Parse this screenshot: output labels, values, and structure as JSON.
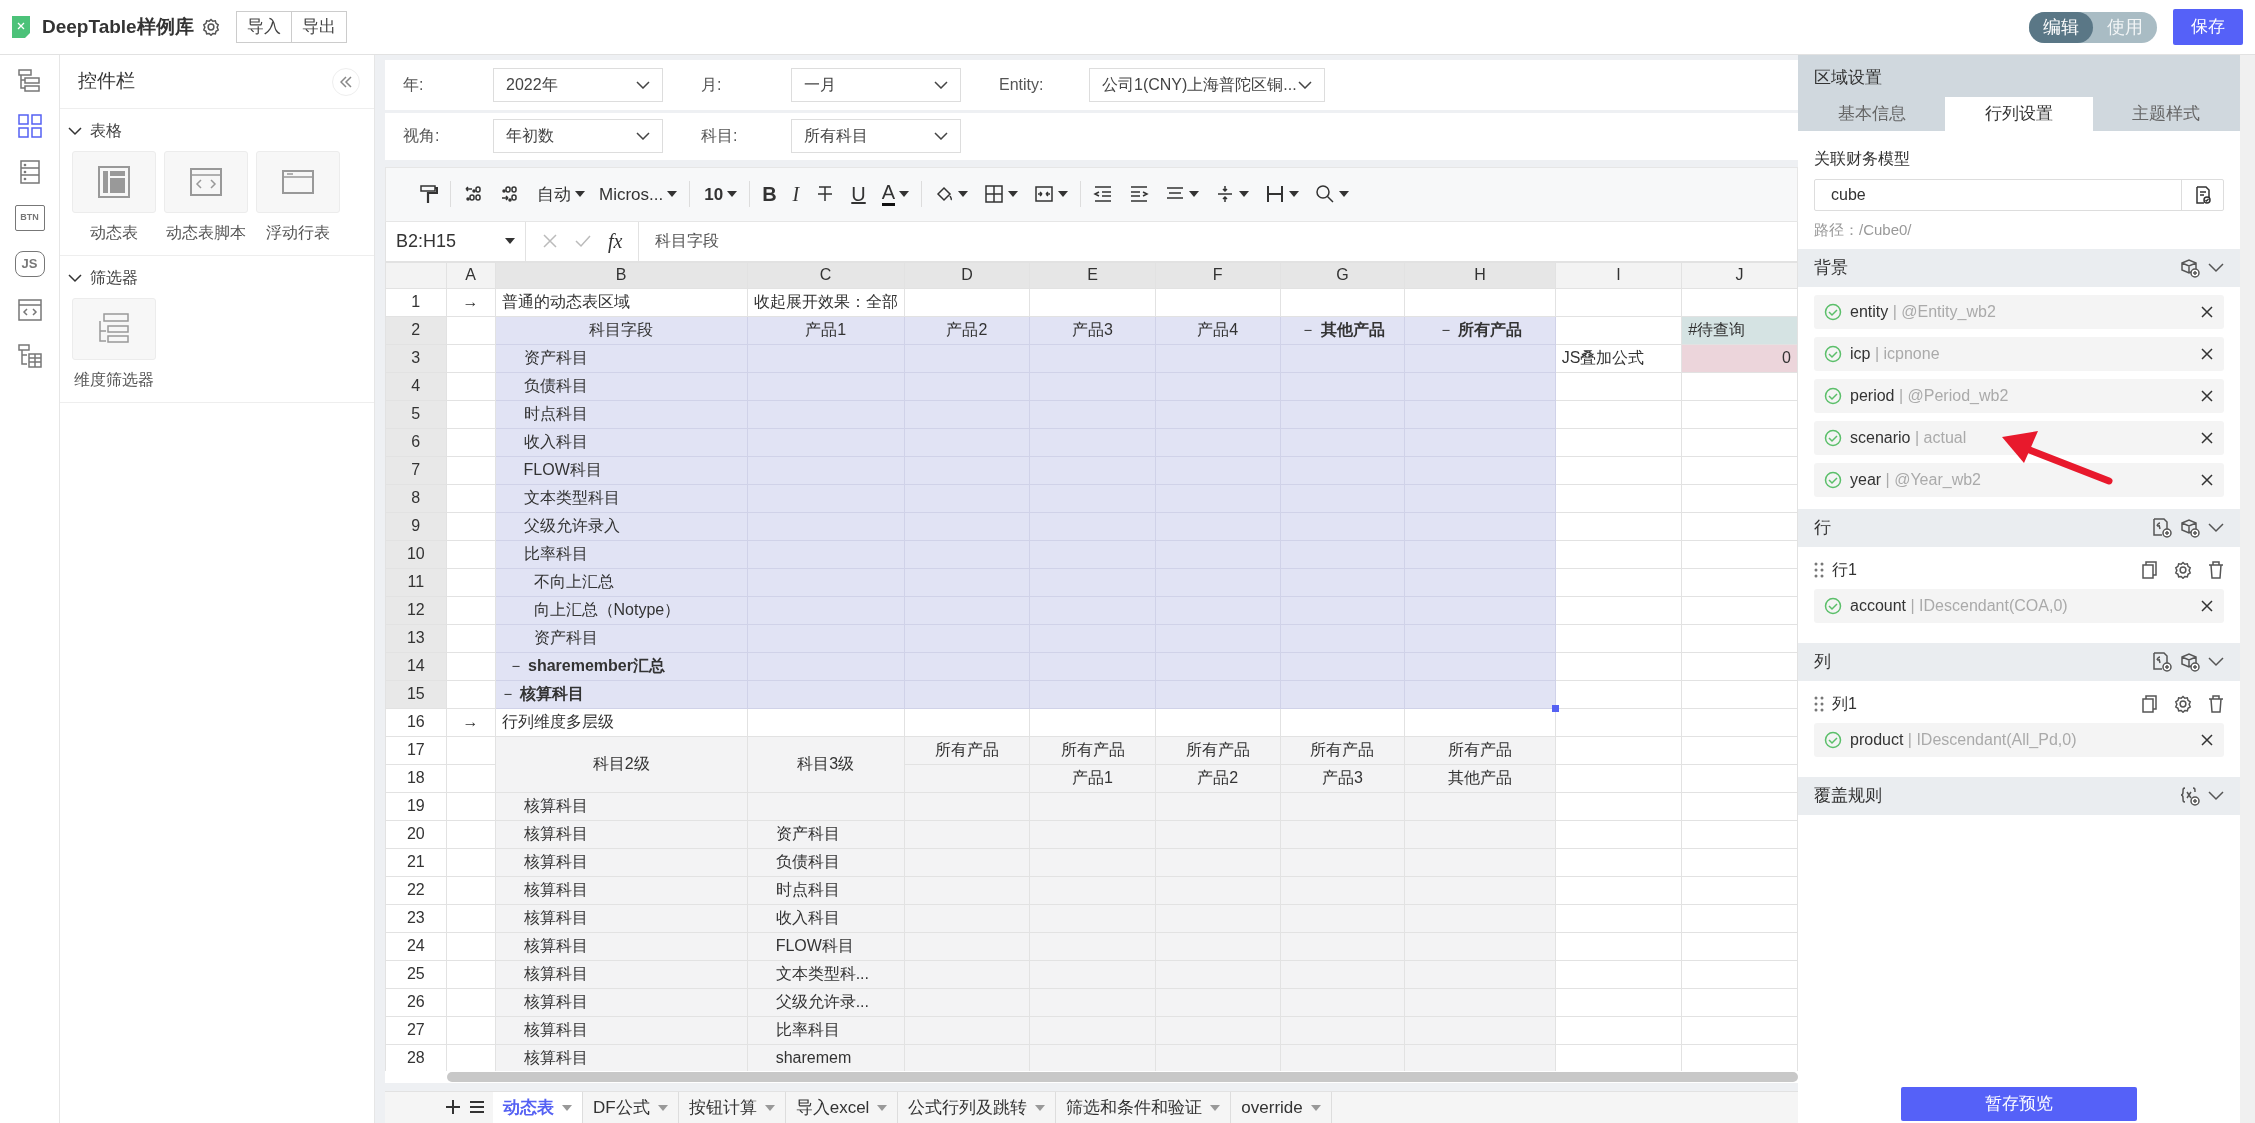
{
  "app": {
    "title": "DeepTable样例库",
    "actions": [
      "导入",
      "导出"
    ],
    "modes": [
      {
        "label": "编辑",
        "selected": true
      },
      {
        "label": "使用",
        "selected": false
      }
    ],
    "save": "保存"
  },
  "rail": [
    {
      "kind": "outline",
      "selected": false
    },
    {
      "kind": "widgets",
      "selected": true
    },
    {
      "kind": "list",
      "selected": false
    },
    {
      "kind": "btn",
      "label": "BTN",
      "selected": false
    },
    {
      "kind": "js",
      "label": "JS",
      "selected": false
    },
    {
      "kind": "code",
      "selected": false
    },
    {
      "kind": "tree-table",
      "selected": false
    }
  ],
  "control_panel": {
    "title": "控件栏",
    "groups": [
      {
        "label": "表格",
        "items": [
          {
            "kind": "dynamic",
            "label": "动态表"
          },
          {
            "kind": "script",
            "label": "动态表脚本"
          },
          {
            "kind": "float",
            "label": "浮动行表"
          }
        ]
      },
      {
        "label": "筛选器",
        "items": [
          {
            "kind": "filter",
            "label": "维度筛选器"
          }
        ]
      }
    ]
  },
  "filters": [
    [
      {
        "label": "年:",
        "value": "2022年"
      },
      {
        "label": "月:",
        "value": "一月"
      },
      {
        "label": "Entity:",
        "value": "公司1(CNY)上海普陀区铜..."
      }
    ],
    [
      {
        "label": "视角:",
        "value": "年初数"
      },
      {
        "label": "科目:",
        "value": "所有科目"
      }
    ]
  ],
  "toolbar": [
    {
      "kind": "format-painter"
    },
    {
      "kind": "sep"
    },
    {
      "kind": "decimal-add"
    },
    {
      "kind": "decimal-remove"
    },
    {
      "kind": "select",
      "value": "自动"
    },
    {
      "kind": "select",
      "value": "Micros..."
    },
    {
      "kind": "sep"
    },
    {
      "kind": "select",
      "value": "10",
      "bold": true
    },
    {
      "kind": "sep"
    },
    {
      "kind": "glyph",
      "glyph": "B",
      "bold": true
    },
    {
      "kind": "glyph",
      "glyph": "I",
      "italic": true
    },
    {
      "kind": "strike"
    },
    {
      "kind": "glyph",
      "glyph": "U",
      "underline": true
    },
    {
      "kind": "font-color",
      "glyph": "A"
    },
    {
      "kind": "sep"
    },
    {
      "kind": "fill"
    },
    {
      "kind": "border"
    },
    {
      "kind": "merge"
    },
    {
      "kind": "sep"
    },
    {
      "kind": "outdent"
    },
    {
      "kind": "indent"
    },
    {
      "kind": "align"
    },
    {
      "kind": "valign"
    },
    {
      "kind": "width"
    },
    {
      "kind": "search"
    }
  ],
  "formula_bar": {
    "name_box": "B2:H15",
    "fx": "fx",
    "value": "科目字段"
  },
  "grid": {
    "columns": [
      {
        "letter": "A",
        "selected": false
      },
      {
        "letter": "B",
        "selected": true
      },
      {
        "letter": "C",
        "selected": true
      },
      {
        "letter": "D",
        "selected": true
      },
      {
        "letter": "E",
        "selected": true
      },
      {
        "letter": "F",
        "selected": true
      },
      {
        "letter": "G",
        "selected": true
      },
      {
        "letter": "H",
        "selected": true
      },
      {
        "letter": "I",
        "selected": false
      },
      {
        "letter": "J",
        "selected": false
      }
    ],
    "rows": [
      {
        "num": "1",
        "kind": "title",
        "selected": false,
        "cells": [
          {
            "text": "→",
            "kind": "mark"
          },
          {
            "text": "普通的动态表区域"
          },
          {
            "text": "收起展开效果：全部"
          },
          null,
          null,
          null,
          null,
          null,
          null,
          null
        ]
      },
      {
        "num": "2",
        "kind": "dynamic",
        "selected": true,
        "cells": [
          null,
          {
            "text": "科目字段",
            "kind": "head"
          },
          {
            "text": "产品1",
            "kind": "head"
          },
          {
            "text": "产品2",
            "kind": "head"
          },
          {
            "text": "产品3",
            "kind": "head"
          },
          {
            "text": "产品4",
            "kind": "head"
          },
          {
            "text": "－ **其他产品**",
            "kind": "head"
          },
          {
            "text": "－ **所有产品**",
            "kind": "head"
          },
          null,
          {
            "text": "#待查询",
            "kind": "query"
          }
        ]
      },
      {
        "num": "3",
        "kind": "dynamic",
        "selected": true,
        "cells": [
          null,
          {
            "text": "资产科目",
            "kind": "item"
          },
          null,
          null,
          null,
          null,
          null,
          null,
          {
            "text": "JS叠加公式"
          },
          {
            "text": "0",
            "kind": "value"
          }
        ]
      },
      {
        "num": "4",
        "kind": "dynamic",
        "selected": true,
        "cells": [
          null,
          {
            "text": "负债科目",
            "kind": "item"
          },
          null,
          null,
          null,
          null,
          null,
          null,
          null,
          null
        ]
      },
      {
        "num": "5",
        "kind": "dynamic",
        "selected": true,
        "cells": [
          null,
          {
            "text": "时点科目",
            "kind": "item"
          },
          null,
          null,
          null,
          null,
          null,
          null,
          null,
          null
        ]
      },
      {
        "num": "6",
        "kind": "dynamic",
        "selected": true,
        "cells": [
          null,
          {
            "text": "收入科目",
            "kind": "item"
          },
          null,
          null,
          null,
          null,
          null,
          null,
          null,
          null
        ]
      },
      {
        "num": "7",
        "kind": "dynamic",
        "selected": true,
        "cells": [
          null,
          {
            "text": "FLOW科目",
            "kind": "item"
          },
          null,
          null,
          null,
          null,
          null,
          null,
          null,
          null
        ]
      },
      {
        "num": "8",
        "kind": "dynamic",
        "selected": true,
        "cells": [
          null,
          {
            "text": "文本类型科目",
            "kind": "item"
          },
          null,
          null,
          null,
          null,
          null,
          null,
          null,
          null
        ]
      },
      {
        "num": "9",
        "kind": "dynamic",
        "selected": true,
        "cells": [
          null,
          {
            "text": "父级允许录入",
            "kind": "item"
          },
          null,
          null,
          null,
          null,
          null,
          null,
          null,
          null
        ]
      },
      {
        "num": "10",
        "kind": "dynamic",
        "selected": true,
        "cells": [
          null,
          {
            "text": "比率科目",
            "kind": "item"
          },
          null,
          null,
          null,
          null,
          null,
          null,
          null,
          null
        ]
      },
      {
        "num": "11",
        "kind": "dynamic",
        "selected": true,
        "cells": [
          null,
          {
            "text": "不向上汇总",
            "kind": "subitem"
          },
          null,
          null,
          null,
          null,
          null,
          null,
          null,
          null
        ]
      },
      {
        "num": "12",
        "kind": "dynamic",
        "selected": true,
        "cells": [
          null,
          {
            "text": "向上汇总（Notype）",
            "kind": "subitem"
          },
          null,
          null,
          null,
          null,
          null,
          null,
          null,
          null
        ]
      },
      {
        "num": "13",
        "kind": "dynamic",
        "selected": true,
        "cells": [
          null,
          {
            "text": "资产科目",
            "kind": "subitem"
          },
          null,
          null,
          null,
          null,
          null,
          null,
          null,
          null
        ]
      },
      {
        "num": "14",
        "kind": "dynamic",
        "selected": true,
        "cells": [
          null,
          {
            "text": "－ **sharemember汇总**",
            "kind": "group"
          },
          null,
          null,
          null,
          null,
          null,
          null,
          null,
          null
        ]
      },
      {
        "num": "15",
        "kind": "dynamic",
        "selected": true,
        "cells": [
          null,
          {
            "text": "－ **核算科目**",
            "kind": "total"
          },
          null,
          null,
          null,
          null,
          null,
          null,
          null,
          null
        ]
      },
      {
        "num": "16",
        "kind": "title",
        "selected": false,
        "cells": [
          {
            "text": "→",
            "kind": "mark"
          },
          {
            "text": "行列维度多层级"
          },
          null,
          null,
          null,
          null,
          null,
          null,
          null,
          null
        ]
      },
      {
        "num": "17",
        "kind": "pivot",
        "selected": false,
        "cells": [
          null,
          {
            "text": "科目2级",
            "kind": "head",
            "rowspan": 2
          },
          {
            "text": "科目3级",
            "kind": "head",
            "rowspan": 2
          },
          {
            "text": "所有产品",
            "kind": "head"
          },
          {
            "text": "所有产品",
            "kind": "head"
          },
          {
            "text": "所有产品",
            "kind": "head"
          },
          {
            "text": "所有产品",
            "kind": "head"
          },
          {
            "text": "所有产品",
            "kind": "head"
          },
          null,
          null
        ]
      },
      {
        "num": "18",
        "kind": "pivot",
        "selected": false,
        "cells": [
          null,
          null,
          {
            "text": "产品1",
            "kind": "head"
          },
          {
            "text": "产品2",
            "kind": "head"
          },
          {
            "text": "产品3",
            "kind": "head"
          },
          {
            "text": "其他产品",
            "kind": "head"
          },
          null,
          null
        ]
      },
      {
        "num": "19",
        "kind": "pivot",
        "selected": false,
        "cells": [
          null,
          {
            "text": "核算科目",
            "kind": "item"
          },
          null,
          null,
          null,
          null,
          null,
          null,
          null,
          null
        ]
      },
      {
        "num": "20",
        "kind": "pivot",
        "selected": false,
        "cells": [
          null,
          {
            "text": "核算科目",
            "kind": "item"
          },
          {
            "text": "资产科目",
            "kind": "item"
          },
          null,
          null,
          null,
          null,
          null,
          null,
          null
        ]
      },
      {
        "num": "21",
        "kind": "pivot",
        "selected": false,
        "cells": [
          null,
          {
            "text": "核算科目",
            "kind": "item"
          },
          {
            "text": "负债科目",
            "kind": "item"
          },
          null,
          null,
          null,
          null,
          null,
          null,
          null
        ]
      },
      {
        "num": "22",
        "kind": "pivot",
        "selected": false,
        "cells": [
          null,
          {
            "text": "核算科目",
            "kind": "item"
          },
          {
            "text": "时点科目",
            "kind": "item"
          },
          null,
          null,
          null,
          null,
          null,
          null,
          null
        ]
      },
      {
        "num": "23",
        "kind": "pivot",
        "selected": false,
        "cells": [
          null,
          {
            "text": "核算科目",
            "kind": "item"
          },
          {
            "text": "收入科目",
            "kind": "item"
          },
          null,
          null,
          null,
          null,
          null,
          null,
          null
        ]
      },
      {
        "num": "24",
        "kind": "pivot",
        "selected": false,
        "cells": [
          null,
          {
            "text": "核算科目",
            "kind": "item"
          },
          {
            "text": "FLOW科目",
            "kind": "item"
          },
          null,
          null,
          null,
          null,
          null,
          null,
          null
        ]
      },
      {
        "num": "25",
        "kind": "pivot",
        "selected": false,
        "cells": [
          null,
          {
            "text": "核算科目",
            "kind": "item"
          },
          {
            "text": "文本类型科...",
            "kind": "item"
          },
          null,
          null,
          null,
          null,
          null,
          null,
          null
        ]
      },
      {
        "num": "26",
        "kind": "pivot",
        "selected": false,
        "cells": [
          null,
          {
            "text": "核算科目",
            "kind": "item"
          },
          {
            "text": "父级允许录...",
            "kind": "item"
          },
          null,
          null,
          null,
          null,
          null,
          null,
          null
        ]
      },
      {
        "num": "27",
        "kind": "pivot",
        "selected": false,
        "cells": [
          null,
          {
            "text": "核算科目",
            "kind": "item"
          },
          {
            "text": "比率科目",
            "kind": "item"
          },
          null,
          null,
          null,
          null,
          null,
          null,
          null
        ]
      },
      {
        "num": "28",
        "kind": "pivot",
        "selected": false,
        "cells": [
          null,
          {
            "text": "核算科目",
            "kind": "item"
          },
          {
            "text": "sharemem",
            "kind": "item"
          },
          null,
          null,
          null,
          null,
          null,
          null,
          null
        ]
      }
    ]
  },
  "sheet_tabs": [
    {
      "label": "动态表",
      "selected": true
    },
    {
      "label": "DF公式",
      "selected": false
    },
    {
      "label": "按钮计算",
      "selected": false
    },
    {
      "label": "导入excel",
      "selected": false
    },
    {
      "label": "公式行列及跳转",
      "selected": false
    },
    {
      "label": "筛选和条件和验证",
      "selected": false
    },
    {
      "label": "override",
      "selected": false
    }
  ],
  "region_panel": {
    "title": "区域设置",
    "tabs": [
      {
        "label": "基本信息",
        "selected": false
      },
      {
        "label": "行列设置",
        "selected": true
      },
      {
        "label": "主题样式",
        "selected": false
      }
    ],
    "model_label": "关联财务模型",
    "model_value": "cube",
    "path": "路径：/Cube0/",
    "sections": [
      {
        "kind": "context",
        "title": "背景",
        "items": [
          {
            "dim": "entity",
            "expr": "| @Entity_wb2",
            "valid": true
          },
          {
            "dim": "icp",
            "expr": "| icpnone",
            "valid": true
          },
          {
            "dim": "period",
            "expr": "| @Period_wb2",
            "valid": true
          },
          {
            "dim": "scenario",
            "expr": "| actual",
            "valid": true
          },
          {
            "dim": "year",
            "expr": "| @Year_wb2",
            "valid": true
          }
        ]
      },
      {
        "kind": "axis",
        "title": "行",
        "groups": [
          {
            "label": "行1",
            "items": [
              {
                "dim": "account",
                "expr": "| IDescendant(COA,0)",
                "valid": true
              }
            ]
          }
        ]
      },
      {
        "kind": "axis",
        "title": "列",
        "groups": [
          {
            "label": "列1",
            "items": [
              {
                "dim": "product",
                "expr": "| IDescendant(All_Pd,0)",
                "valid": true
              }
            ]
          }
        ]
      },
      {
        "kind": "rules",
        "title": "覆盖规则"
      }
    ],
    "preview": "暂存预览"
  }
}
